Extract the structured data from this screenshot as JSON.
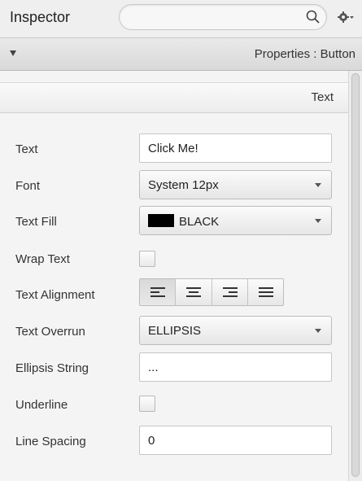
{
  "header": {
    "title": "Inspector",
    "search_placeholder": ""
  },
  "properties_bar": {
    "text": "Properties : Button"
  },
  "section": {
    "title": "Text"
  },
  "fields": {
    "text": {
      "label": "Text",
      "value": "Click Me!"
    },
    "font": {
      "label": "Font",
      "value": "System 12px"
    },
    "text_fill": {
      "label": "Text Fill",
      "value": "BLACK",
      "color": "#000000"
    },
    "wrap_text": {
      "label": "Wrap Text",
      "checked": false
    },
    "text_alignment": {
      "label": "Text Alignment",
      "options": [
        "left-align-icon",
        "center-align-icon",
        "right-align-icon",
        "justify-align-icon"
      ],
      "selected": "left-align-icon"
    },
    "text_overrun": {
      "label": "Text Overrun",
      "value": "ELLIPSIS"
    },
    "ellipsis_string": {
      "label": "Ellipsis String",
      "value": "..."
    },
    "underline": {
      "label": "Underline",
      "checked": false
    },
    "line_spacing": {
      "label": "Line Spacing",
      "value": "0"
    }
  }
}
